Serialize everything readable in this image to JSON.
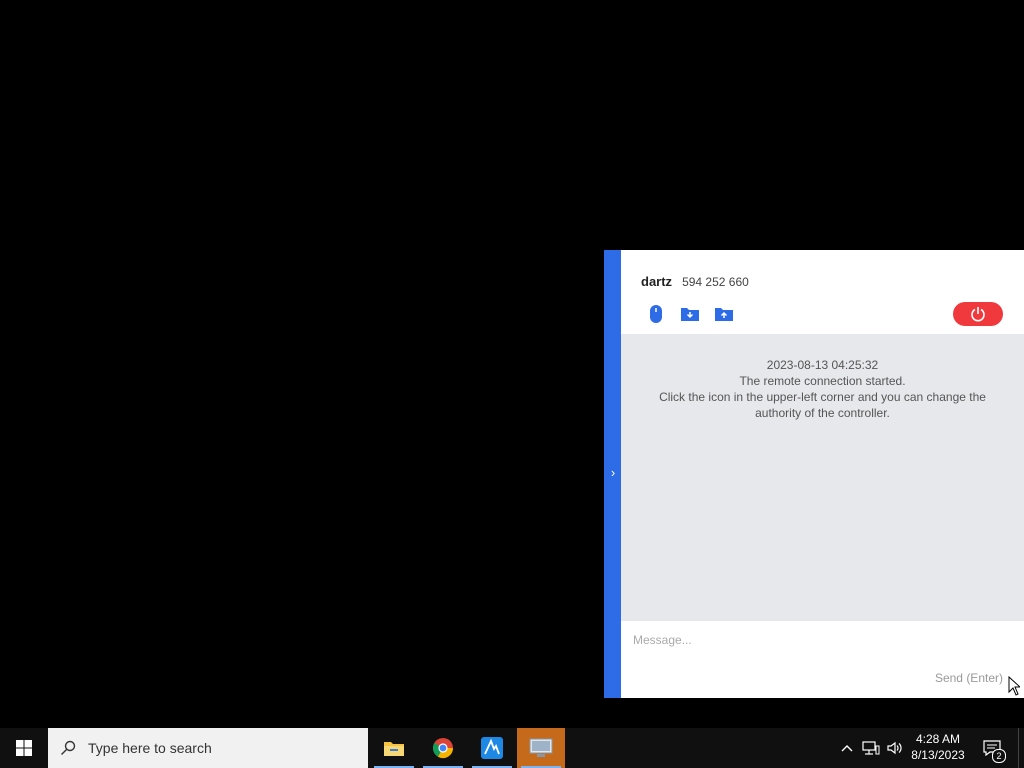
{
  "panel": {
    "user_name": "dartz",
    "session_id": "594 252 660",
    "toggle_icon": "chevron-right-icon",
    "toolbar": [
      {
        "name": "mouse-control-icon"
      },
      {
        "name": "file-download-icon"
      },
      {
        "name": "file-upload-icon"
      }
    ],
    "power_icon": "power-icon",
    "accent_color": "#2e6be6",
    "power_color": "#f0393d",
    "chat": {
      "timestamp": "2023-08-13 04:25:32",
      "line1": "The remote connection started.",
      "line2": "Click the icon in the upper-left corner and you can change the",
      "line3": "authority of the controller."
    },
    "message_placeholder": "Message...",
    "send_label": "Send (Enter)"
  },
  "taskbar": {
    "search_placeholder": "Type here to search",
    "apps": [
      "file-explorer-icon",
      "chrome-icon",
      "remote-app-icon",
      "control-app-icon"
    ],
    "clock_time": "4:28 AM",
    "clock_date": "8/13/2023",
    "notification_count": "2"
  }
}
